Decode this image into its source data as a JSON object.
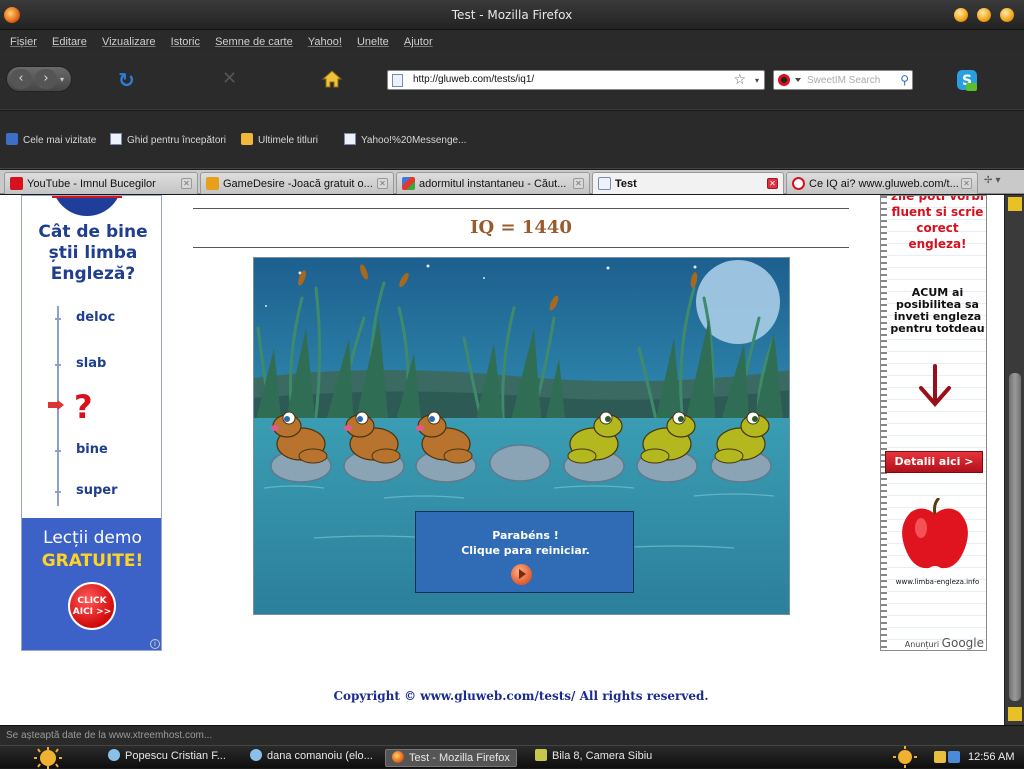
{
  "window": {
    "title": "Test - Mozilla Firefox"
  },
  "menu": [
    "Fișier",
    "Editare",
    "Vizualizare",
    "Istoric",
    "Semne de carte",
    "Yahoo!",
    "Unelte",
    "Ajutor"
  ],
  "navbar": {
    "url": "http://gluweb.com/tests/iq1/",
    "search_placeholder": "SweetIM Search"
  },
  "bookmarks": [
    "Cele mai vizitate",
    "Ghid pentru începători",
    "Ultimele titluri",
    "Yahoo!%20Messenge..."
  ],
  "tabs": [
    {
      "label": "YouTube - Imnul Bucegilor",
      "active": false,
      "icon": "youtube-icon"
    },
    {
      "label": "GameDesire -Joacă gratuit o...",
      "active": false,
      "icon": "gamedesire-icon"
    },
    {
      "label": "adormitul instantaneu - Căut...",
      "active": false,
      "icon": "google-icon"
    },
    {
      "label": "Test",
      "active": true,
      "icon": "page-icon"
    },
    {
      "label": "Ce IQ ai? www.gluweb.com/t...",
      "active": false,
      "icon": "gluweb-icon"
    }
  ],
  "page": {
    "iq_result": "IQ = 1440",
    "message_line1": "Parabéns !",
    "message_line2": "Clique para reiniciar.",
    "copyright": "Copyright © www.gluweb.com/tests/ All rights reserved."
  },
  "ad_left": {
    "question": "Cât de bine știi limba Engleză?",
    "options": [
      "deloc",
      "slab",
      "?",
      "bine",
      "super"
    ],
    "demo_line1": "Lecții demo",
    "demo_line2": "GRATUITE!",
    "click_label": "CLICK AICI >>"
  },
  "ad_right": {
    "top_text": "zile poti vorbi fluent si scrie corect engleza!",
    "mid_text": "ACUM ai posibilitea sa inveti engleza pentru totdeau",
    "button": "Detalii aici >",
    "site": "www.limba-engleza.info",
    "ads_by": "Anunțuri",
    "ads_brand": "Google"
  },
  "status": {
    "text": "Se așteaptă date de la www.xtreemhost.com..."
  },
  "taskbar": {
    "items": [
      "Popescu Cristian F...",
      "dana comanoiu (elo...",
      "Test - Mozilla Firefox",
      "Bila 8, Camera Sibiu"
    ],
    "clock": "12:56 AM"
  },
  "colors": {
    "iq_text": "#9a5a2c",
    "copyright_text": "#1a2a8f",
    "game_message_bg": "#2f6cb5",
    "brown_frog": "#b8742e",
    "green_frog": "#b3b81f"
  },
  "game": {
    "frogs": [
      "brown",
      "brown",
      "brown",
      "green",
      "green",
      "green"
    ]
  }
}
